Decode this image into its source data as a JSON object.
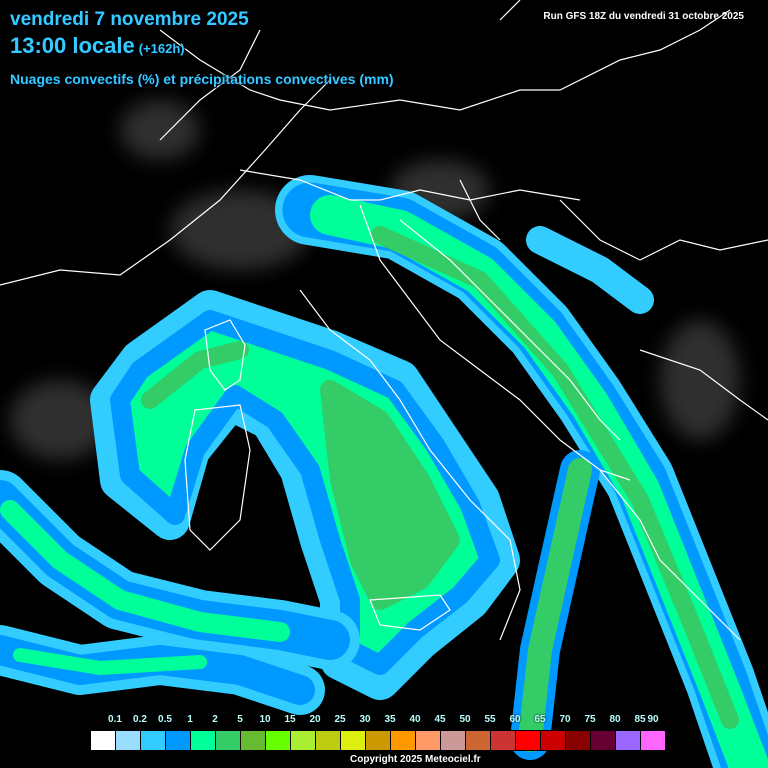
{
  "header": {
    "date": "vendredi 7 novembre 2025",
    "time": "13:00 locale",
    "lead": "(+162h)",
    "subtitle": "Nuages convectifs (%) et précipitations convectives (mm)",
    "run": "Run GFS 18Z du vendredi 31 octobre 2025"
  },
  "legend": {
    "labels": [
      "0.1",
      "0.2",
      "0.5",
      "1",
      "2",
      "5",
      "10",
      "15",
      "20",
      "25",
      "30",
      "35",
      "40",
      "45",
      "50",
      "55",
      "60",
      "65",
      "70",
      "75",
      "80",
      "85",
      "90"
    ],
    "colors": [
      "#ffffff",
      "#99ddff",
      "#33ccff",
      "#0099ff",
      "#00ff99",
      "#33cc66",
      "#66bb33",
      "#66ff00",
      "#aaee33",
      "#bbcc11",
      "#ddee11",
      "#cc9900",
      "#ff9900",
      "#ff9966",
      "#cc9999",
      "#cc6633",
      "#cc3333",
      "#ff0000",
      "#cc0000",
      "#880000",
      "#660033",
      "#9966ff",
      "#ff66ff"
    ]
  },
  "copyright": "Copyright 2025 Meteociel.fr"
}
